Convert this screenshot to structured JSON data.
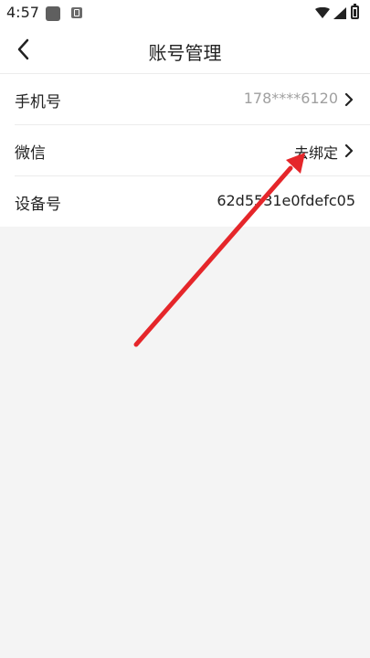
{
  "status_bar": {
    "time": "4:57"
  },
  "header": {
    "title": "账号管理"
  },
  "rows": [
    {
      "label": "手机号",
      "value": "178****6120"
    },
    {
      "label": "微信",
      "value": "去绑定"
    },
    {
      "label": "设备号",
      "value": "62d5531e0fdefc05"
    }
  ],
  "colors": {
    "annotation_arrow": "#e5262a",
    "secondary_text": "#a0a0a0",
    "background": "#f4f4f4"
  }
}
